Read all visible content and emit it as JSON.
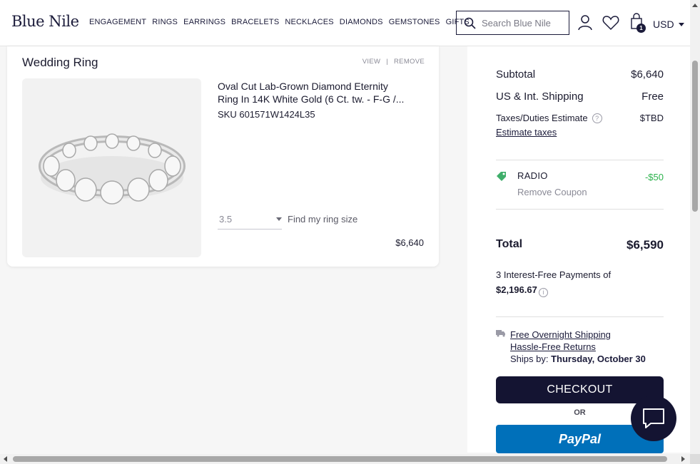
{
  "header": {
    "logo": "Blue Nile",
    "nav": [
      "ENGAGEMENT",
      "RINGS",
      "EARRINGS",
      "BRACELETS",
      "NECKLACES",
      "DIAMONDS",
      "GEMSTONES",
      "GIFTS"
    ],
    "search_placeholder": "Search Blue Nile",
    "cart_count": "1",
    "currency": "USD"
  },
  "item": {
    "section_title": "Wedding Ring",
    "view_label": "VIEW",
    "separator": "|",
    "remove_label": "REMOVE",
    "name_line1": "Oval Cut Lab-Grown Diamond Eternity",
    "name_line2": "Ring In 14K White Gold (6 Ct. tw. - F-G /...",
    "sku": "SKU 601571W1424L35",
    "ring_size": "3.5",
    "find_size_label": "Find my ring size",
    "price": "$6,640"
  },
  "summary": {
    "subtotal_label": "Subtotal",
    "subtotal_value": "$6,640",
    "shipping_label": "US & Int. Shipping",
    "shipping_value": "Free",
    "tax_label": "Taxes/Duties Estimate",
    "tax_help": "?",
    "tax_value": "$TBD",
    "estimate_link": "Estimate taxes",
    "coupon_code": "RADIO",
    "coupon_remove": "Remove Coupon",
    "coupon_amount": "-$50",
    "total_label": "Total",
    "total_value": "$6,590",
    "installments_text": "3 Interest-Free Payments of",
    "installments_amount": "$2,196.67",
    "info_icon": "i",
    "shipping_link": "Free Overnight Shipping",
    "returns_link": "Hassle-Free Returns",
    "ships_by_label": "Ships by:",
    "ships_by_date": "Thursday, October 30",
    "checkout_label": "CHECKOUT",
    "or_label": "OR",
    "paypal_label": "PayPal"
  },
  "colors": {
    "brand_navy": "#141432",
    "paypal_blue": "#0070ba",
    "discount_green": "#2bb24c"
  }
}
